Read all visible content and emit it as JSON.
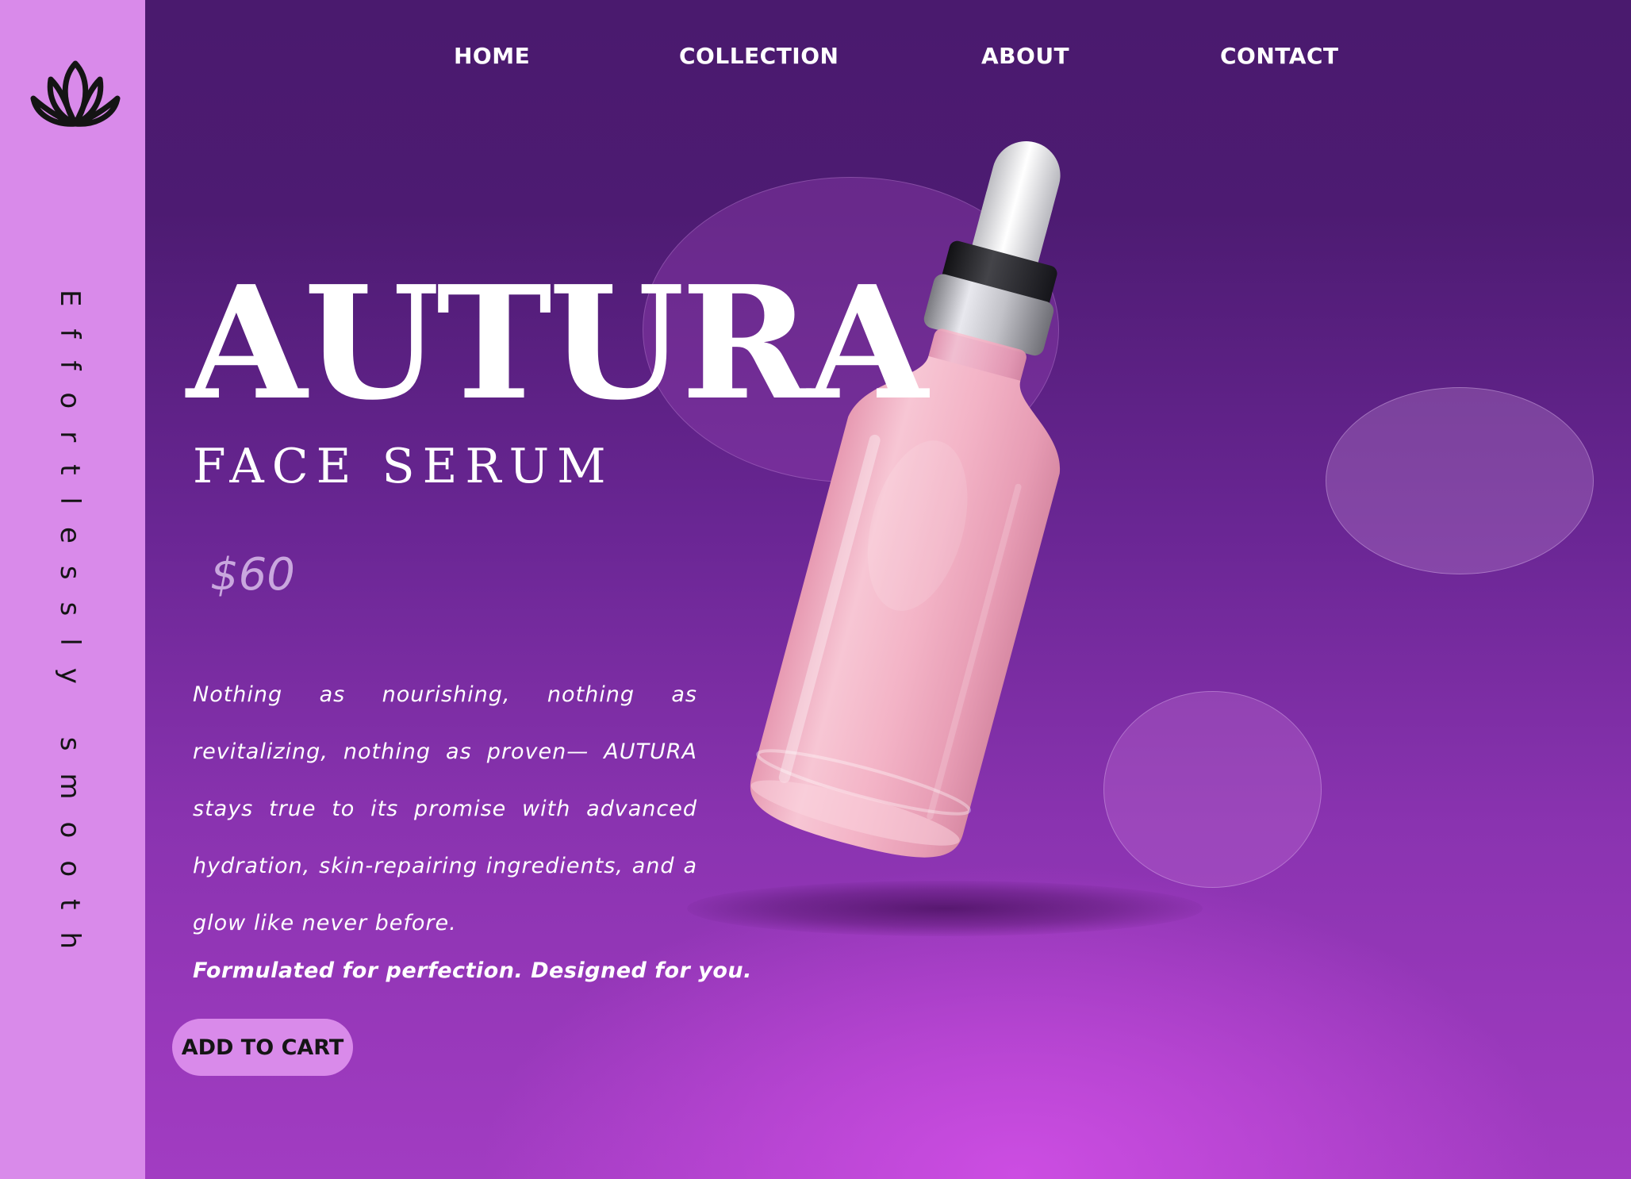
{
  "sidebar": {
    "logo_icon": "lotus-icon",
    "tagline": "Effortlessly smooth"
  },
  "nav": {
    "items": [
      {
        "label": "HOME"
      },
      {
        "label": "COLLECTION"
      },
      {
        "label": "ABOUT"
      },
      {
        "label": "CONTACT"
      }
    ]
  },
  "product": {
    "brand": "AUTURA",
    "subtitle": "FACE SERUM",
    "price": "$60",
    "description": "Nothing as nourishing, nothing as revitalizing, nothing as proven— AUTURA stays true to its promise with advanced hydration, skin-repairing ingredients, and a glow like never before.",
    "tagline": "Formulated for perfection. Designed for you.",
    "cta_label": "ADD TO CART",
    "image_icon": "serum-bottle-image"
  },
  "colors": {
    "sidebar": "#d98aea",
    "background_top": "#4a1a6e",
    "background_bottom": "#cc4de2",
    "cta": "#d98aea",
    "price": "#c9a7de",
    "serum": "#f2b6c8"
  }
}
